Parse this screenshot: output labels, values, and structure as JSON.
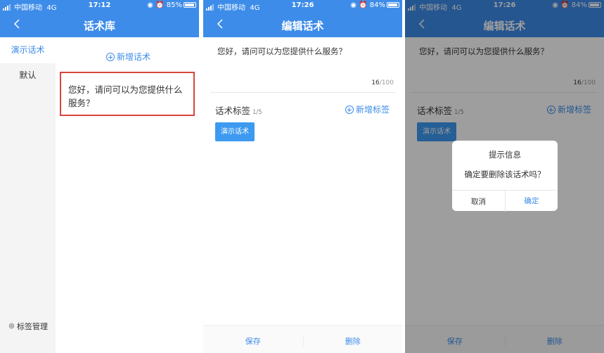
{
  "status": {
    "carrier": "中国移动",
    "network": "4G",
    "screen1_time": "17:12",
    "screen1_battery": "85%",
    "screen2_time": "17:26",
    "screen2_battery": "84%",
    "screen3_time": "17:26",
    "screen3_battery": "84%"
  },
  "screen1": {
    "title": "话术库",
    "sidebar_active": "演示话术",
    "sidebar_item": "默认",
    "add_speech": "新增话术",
    "speech_text": "您好，请问可以为您提供什么服务？",
    "tag_manage": "标签管理"
  },
  "edit": {
    "title": "编辑话术",
    "text": "您好，请问可以为您提供什么服务？",
    "count": "16",
    "max": "/100",
    "tag_label": "话术标签",
    "tag_count": "1/5",
    "add_tag": "新增标签",
    "chip": "演示话术",
    "save": "保存",
    "delete": "删除"
  },
  "dialog": {
    "title": "提示信息",
    "message": "确定要删除该话术吗？",
    "cancel": "取消",
    "confirm": "确定"
  },
  "colors": {
    "brand": "#3d8ce9",
    "highlight_border": "#d9453d"
  }
}
